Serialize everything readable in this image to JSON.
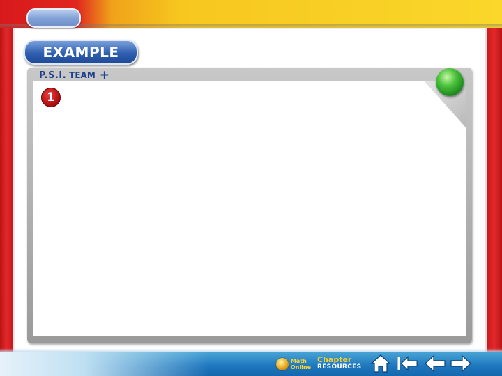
{
  "header": {
    "tab_pill_color": "#7f9fd6",
    "accent_red": "#d8191b",
    "accent_yellow": "#fad72a"
  },
  "example": {
    "label": "EXAMPLE"
  },
  "panel": {
    "psi_label": "P.S.I.",
    "team_label": "TEAM",
    "plus_symbol": "+",
    "step_number": "1",
    "status_indicator_color": "#4cc33d"
  },
  "footer": {
    "math_online_line1": "Math",
    "math_online_line2": "Online",
    "chapter_label": "Chapter",
    "resources_label": "RESOURCES",
    "nav_icons": [
      "home-icon",
      "first-page-icon",
      "previous-icon",
      "next-icon"
    ]
  }
}
